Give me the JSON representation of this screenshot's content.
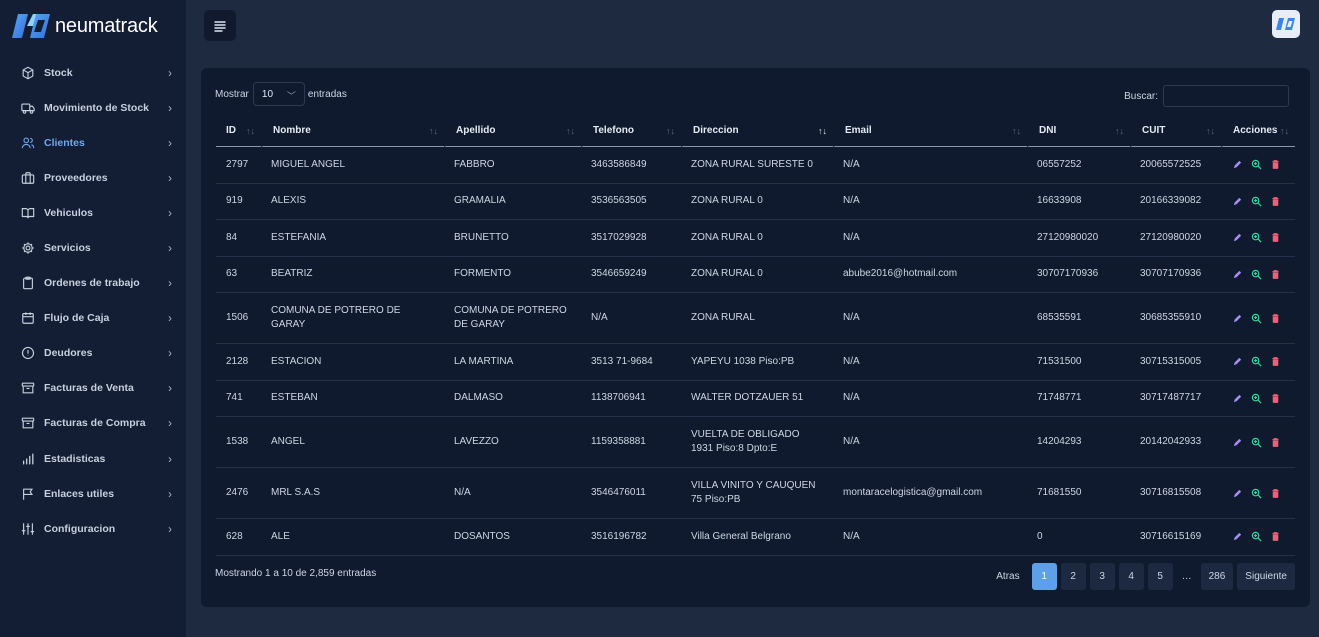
{
  "brand": {
    "name": "neumatrack"
  },
  "sidebar": {
    "items": [
      {
        "label": "Stock",
        "icon": "cube-icon",
        "active": false
      },
      {
        "label": "Movimiento de Stock",
        "icon": "truck-icon",
        "active": false
      },
      {
        "label": "Clientes",
        "icon": "users-icon",
        "active": true
      },
      {
        "label": "Proveedores",
        "icon": "briefcase-icon",
        "active": false
      },
      {
        "label": "Vehiculos",
        "icon": "book-icon",
        "active": false
      },
      {
        "label": "Servicios",
        "icon": "gear-icon",
        "active": false
      },
      {
        "label": "Ordenes de trabajo",
        "icon": "clipboard-icon",
        "active": false
      },
      {
        "label": "Flujo de Caja",
        "icon": "calendar-icon",
        "active": false
      },
      {
        "label": "Deudores",
        "icon": "alert-circle-icon",
        "active": false
      },
      {
        "label": "Facturas de Venta",
        "icon": "archive-icon",
        "active": false
      },
      {
        "label": "Facturas de Compra",
        "icon": "archive-icon",
        "active": false
      },
      {
        "label": "Estadisticas",
        "icon": "bar-chart-icon",
        "active": false
      },
      {
        "label": "Enlaces utiles",
        "icon": "flag-icon",
        "active": false
      },
      {
        "label": "Configuracion",
        "icon": "sliders-icon",
        "active": false
      }
    ]
  },
  "controls": {
    "show_label": "Mostrar",
    "length_value": "10",
    "entries_label": "entradas",
    "search_label": "Buscar:",
    "search_value": ""
  },
  "table": {
    "columns": [
      "ID",
      "Nombre",
      "Apellido",
      "Telefono",
      "Direccion",
      "Email",
      "DNI",
      "CUIT",
      "Acciones"
    ],
    "rows": [
      [
        "2797",
        "MIGUEL ANGEL",
        "FABBRO",
        "3463586849",
        "ZONA RURAL SURESTE 0",
        "N/A",
        "06557252",
        "20065572525"
      ],
      [
        "919",
        "ALEXIS",
        "GRAMALIA",
        "3536563505",
        "ZONA RURAL 0",
        "N/A",
        "16633908",
        "20166339082"
      ],
      [
        "84",
        "ESTEFANIA",
        "BRUNETTO",
        "3517029928",
        "ZONA RURAL 0",
        "N/A",
        "27120980020",
        "27120980020"
      ],
      [
        "63",
        "BEATRIZ",
        "FORMENTO",
        "3546659249",
        "ZONA RURAL 0",
        "abube2016@hotmail.com",
        "30707170936",
        "30707170936"
      ],
      [
        "1506",
        "COMUNA DE POTRERO DE GARAY",
        "COMUNA DE POTRERO DE GARAY",
        "N/A",
        "ZONA RURAL",
        "N/A",
        "68535591",
        "30685355910"
      ],
      [
        "2128",
        "ESTACION",
        "LA MARTINA",
        "3513 71-9684",
        "YAPEYU 1038 Piso:PB",
        "N/A",
        "71531500",
        "30715315005"
      ],
      [
        "741",
        "ESTEBAN",
        "DALMASO",
        "1138706941",
        "WALTER DOTZAUER 51",
        "N/A",
        "71748771",
        "30717487717"
      ],
      [
        "1538",
        "ANGEL",
        "LAVEZZO",
        "1159358881",
        "VUELTA DE OBLIGADO 1931 Piso:8 Dpto:E",
        "N/A",
        "14204293",
        "20142042933"
      ],
      [
        "2476",
        "MRL S.A.S",
        "N/A",
        "3546476011",
        "VILLA VINITO Y CAUQUEN 75 Piso:PB",
        "montaracelogistica@gmail.com",
        "71681550",
        "30716815508"
      ],
      [
        "628",
        "ALE",
        "DOSANTOS",
        "3516196782",
        "Villa General Belgrano",
        "N/A",
        "0",
        "30716615169"
      ]
    ]
  },
  "footer": {
    "info": "Mostrando 1 a 10 de 2,859 entradas",
    "prev": "Atras",
    "pages": [
      "1",
      "2",
      "3",
      "4",
      "5"
    ],
    "ellipsis": "…",
    "last_page": "286",
    "next": "Siguiente",
    "current_page": "1"
  },
  "colors": {
    "accent": "#5ea0e8",
    "edit": "#a78bfa",
    "view": "#34d399",
    "delete": "#f0607a"
  }
}
